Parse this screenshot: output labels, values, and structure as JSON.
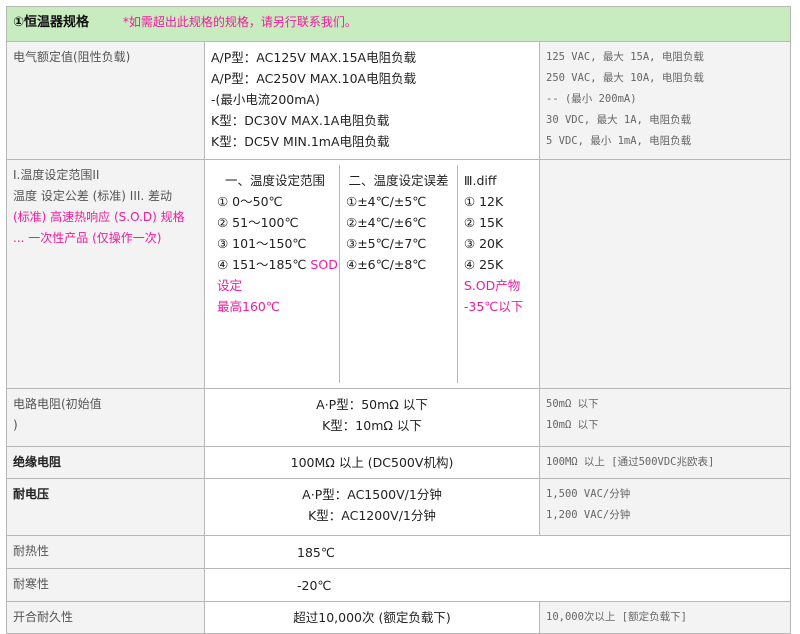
{
  "header": {
    "title": "①恒温器规格",
    "note": "*如需超出此规格的规格，请另行联系我们。"
  },
  "rows": {
    "rating": {
      "label": "电气额定值(阻性负载)",
      "values": [
        "A/P型：AC125V MAX.15A电阻负载",
        "A/P型：AC250V MAX.10A电阻负载",
        "-(最小电流200mA)",
        "K型：DC30V MAX.1A电阻负载",
        "K型：DC5V MIN.1mA电阻负载"
      ],
      "english": [
        "125 VAC, 最大 15A, 电阻负载",
        "250 VAC, 最大 10A, 电阻负载",
        "-- (最小 200mA)",
        "30 VDC, 最大 1A, 电阻负载",
        "5 VDC, 最小 1mA, 电阻负载"
      ]
    },
    "temp": {
      "label_lines": [
        "I.温度设定范围II",
        "温度 设定公差 (标准) III. 差动",
        "(标准) 高速热响应 (S.O.D) 规格",
        "... 一次性产品 (仅操作一次)"
      ],
      "col1": {
        "head": "一、温度设定范围",
        "items": [
          "① 0～50℃",
          "② 51～100℃",
          "③ 101～150℃",
          "④ 151～185℃ "
        ],
        "sod_inline": "SOD",
        "sod_lines": [
          "设定",
          "最高160℃"
        ]
      },
      "col2": {
        "head": "二、温度设定误差",
        "items": [
          "①±4℃/±5℃",
          "②±4℃/±6℃",
          "③±5℃/±7℃",
          "④±6℃/±8℃"
        ]
      },
      "col3": {
        "head": "Ⅲ.diff",
        "items": [
          "① 12K",
          "② 15K",
          "③ 20K",
          "④ 25K"
        ],
        "sod_lines": [
          "S.OD产物",
          "-35℃以下"
        ]
      }
    },
    "resistance": {
      "label_lines": [
        "电路电阻(初始值",
        ")"
      ],
      "values": [
        "A·P型：50mΩ 以下",
        "K型：10mΩ 以下"
      ],
      "english": [
        "50mΩ 以下",
        "10mΩ 以下"
      ]
    },
    "insulation": {
      "label": "绝缘电阻",
      "value": "100MΩ 以上 (DC500V机构)",
      "english": "100MΩ 以上 [通过500VDC兆欧表]"
    },
    "voltage": {
      "label": "耐电压",
      "values": [
        "A·P型：AC1500V/1分钟",
        "K型：AC1200V/1分钟"
      ],
      "english": [
        "1,500 VAC/分钟",
        "1,200 VAC/分钟"
      ]
    },
    "heat": {
      "label": "耐热性",
      "value": "185℃"
    },
    "cold": {
      "label": "耐寒性",
      "value": "-20℃"
    },
    "durability": {
      "label": "开合耐久性",
      "value": "超过10,000次 (额定负载下)",
      "english": "10,000次以上 [额定负载下]"
    }
  }
}
